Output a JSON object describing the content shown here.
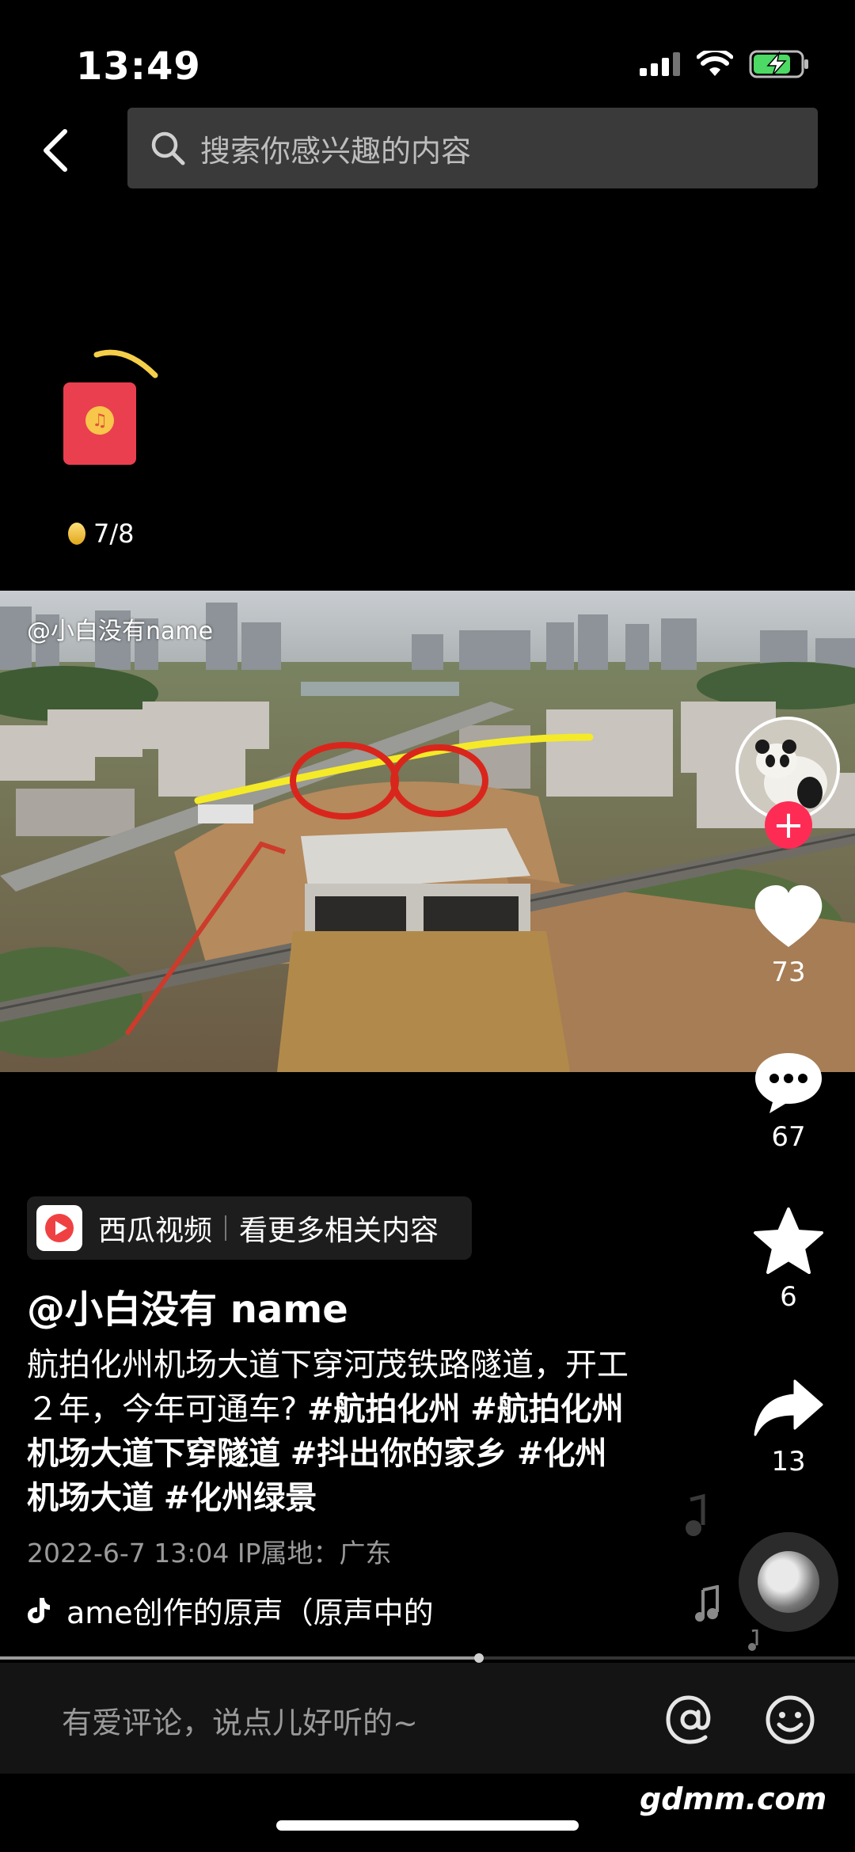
{
  "status": {
    "time": "13:49"
  },
  "search": {
    "placeholder": "搜索你感兴趣的内容"
  },
  "reward": {
    "progress": "7/8"
  },
  "video": {
    "watermark": "@小白没有name"
  },
  "actions": {
    "likes": "73",
    "comments": "67",
    "favorites": "6",
    "shares": "13"
  },
  "source": {
    "name": "西瓜视频",
    "link": "看更多相关内容"
  },
  "post": {
    "author": "@小白没有 name",
    "caption_text": "航拍化州机场大道下穿河茂铁路隧道，开工２年，今年可通车? ",
    "hashtags": [
      "#航拍化州",
      "#航拍化州机场大道下穿隧道",
      "#抖出你的家乡",
      "#化州机场大道",
      "#化州绿景"
    ],
    "meta": "2022-6-7 13:04  IP属地：广东"
  },
  "music": {
    "title": "ame创作的原声（原声中的"
  },
  "comment": {
    "placeholder": "有爱评论，说点儿好听的~"
  },
  "playback": {
    "progress": 0.56
  },
  "watermark": {
    "site": "gdmm.com"
  },
  "colors": {
    "accent": "#fe2c55",
    "envelope": "#ea3f4f",
    "search_bg": "#3a3a3a"
  }
}
